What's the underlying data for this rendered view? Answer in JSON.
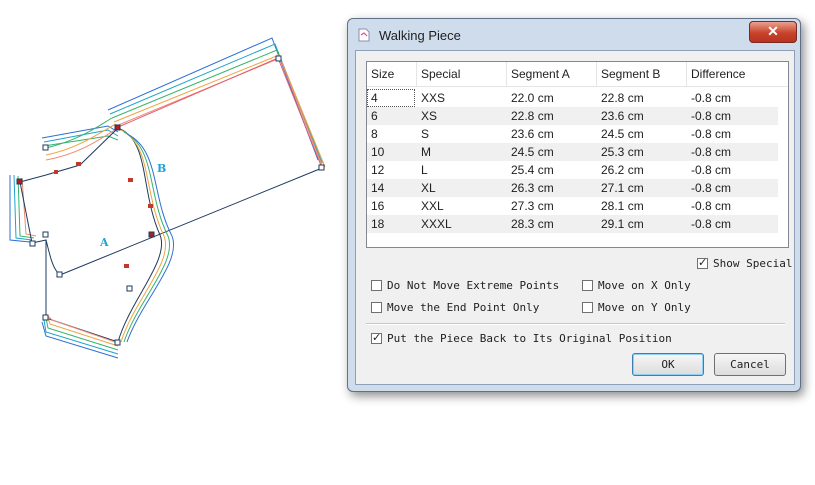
{
  "canvas": {
    "label_a": "A",
    "label_b": "B",
    "line_color": "#1e3a5f",
    "label_color": "#1aa3d6"
  },
  "dialog": {
    "title": "Walking Piece",
    "close_label": "✕",
    "table": {
      "headers": [
        "Size",
        "Special",
        "Segment A",
        "Segment B",
        "Difference"
      ],
      "rows": [
        [
          "4",
          "XXS",
          "22.0 cm",
          "22.8 cm",
          "-0.8 cm"
        ],
        [
          "6",
          "XS",
          "22.8 cm",
          "23.6 cm",
          "-0.8 cm"
        ],
        [
          "8",
          "S",
          "23.6 cm",
          "24.5 cm",
          "-0.8 cm"
        ],
        [
          "10",
          "M",
          "24.5 cm",
          "25.3 cm",
          "-0.8 cm"
        ],
        [
          "12",
          "L",
          "25.4 cm",
          "26.2 cm",
          "-0.8 cm"
        ],
        [
          "14",
          "XL",
          "26.3 cm",
          "27.1 cm",
          "-0.8 cm"
        ],
        [
          "16",
          "XXL",
          "27.3 cm",
          "28.1 cm",
          "-0.8 cm"
        ],
        [
          "18",
          "XXXL",
          "28.3 cm",
          "29.1 cm",
          "-0.8 cm"
        ]
      ]
    },
    "show_special": {
      "label": "Show Special",
      "checked": true
    },
    "options": {
      "do_not_move_extreme": {
        "label": "Do Not Move Extreme Points",
        "checked": false
      },
      "move_on_x": {
        "label": "Move on X Only",
        "checked": false
      },
      "move_end_point": {
        "label": "Move the End Point Only",
        "checked": false
      },
      "move_on_y": {
        "label": "Move on Y Only",
        "checked": false
      },
      "put_back": {
        "label": "Put the Piece Back to Its Original Position",
        "checked": true
      }
    },
    "ok_label": "OK",
    "cancel_label": "Cancel"
  }
}
